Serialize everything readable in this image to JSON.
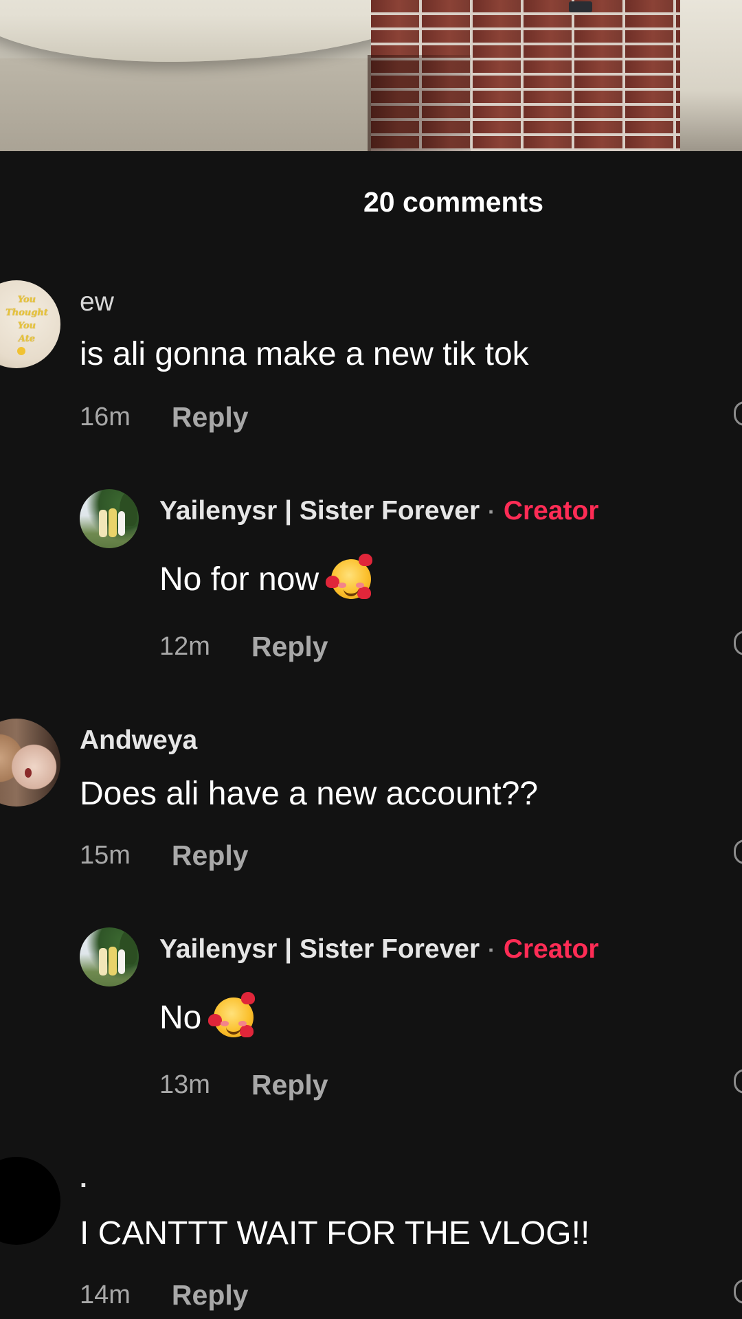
{
  "video": {
    "description_icon": "video-thumbnail"
  },
  "header": {
    "title": "20 comments"
  },
  "comments": [
    {
      "username": "ew",
      "text": "is ali gonna make a new tik tok",
      "time": "16m",
      "reply_label": "Reply",
      "avatar_text": [
        "You",
        "Thought",
        "You",
        "Ate"
      ]
    },
    {
      "username": "Yailenysr | Sister Forever",
      "separator": "·",
      "badge": "Creator",
      "text": "No for now",
      "emoji": "smiling-face-with-hearts",
      "time": "12m",
      "reply_label": "Reply"
    },
    {
      "username": "Andweya",
      "text": "Does ali have a new account??",
      "time": "15m",
      "reply_label": "Reply"
    },
    {
      "username": "Yailenysr | Sister Forever",
      "separator": "·",
      "badge": "Creator",
      "text": "No",
      "emoji": "smiling-face-with-hearts",
      "time": "13m",
      "reply_label": "Reply"
    },
    {
      "username": ".",
      "text": "I CANTTT WAIT FOR THE VLOG!!",
      "time": "14m",
      "reply_label": "Reply"
    }
  ],
  "colors": {
    "background": "#121212",
    "creator_badge": "#fe2c55",
    "muted": "#a8a8a8"
  }
}
